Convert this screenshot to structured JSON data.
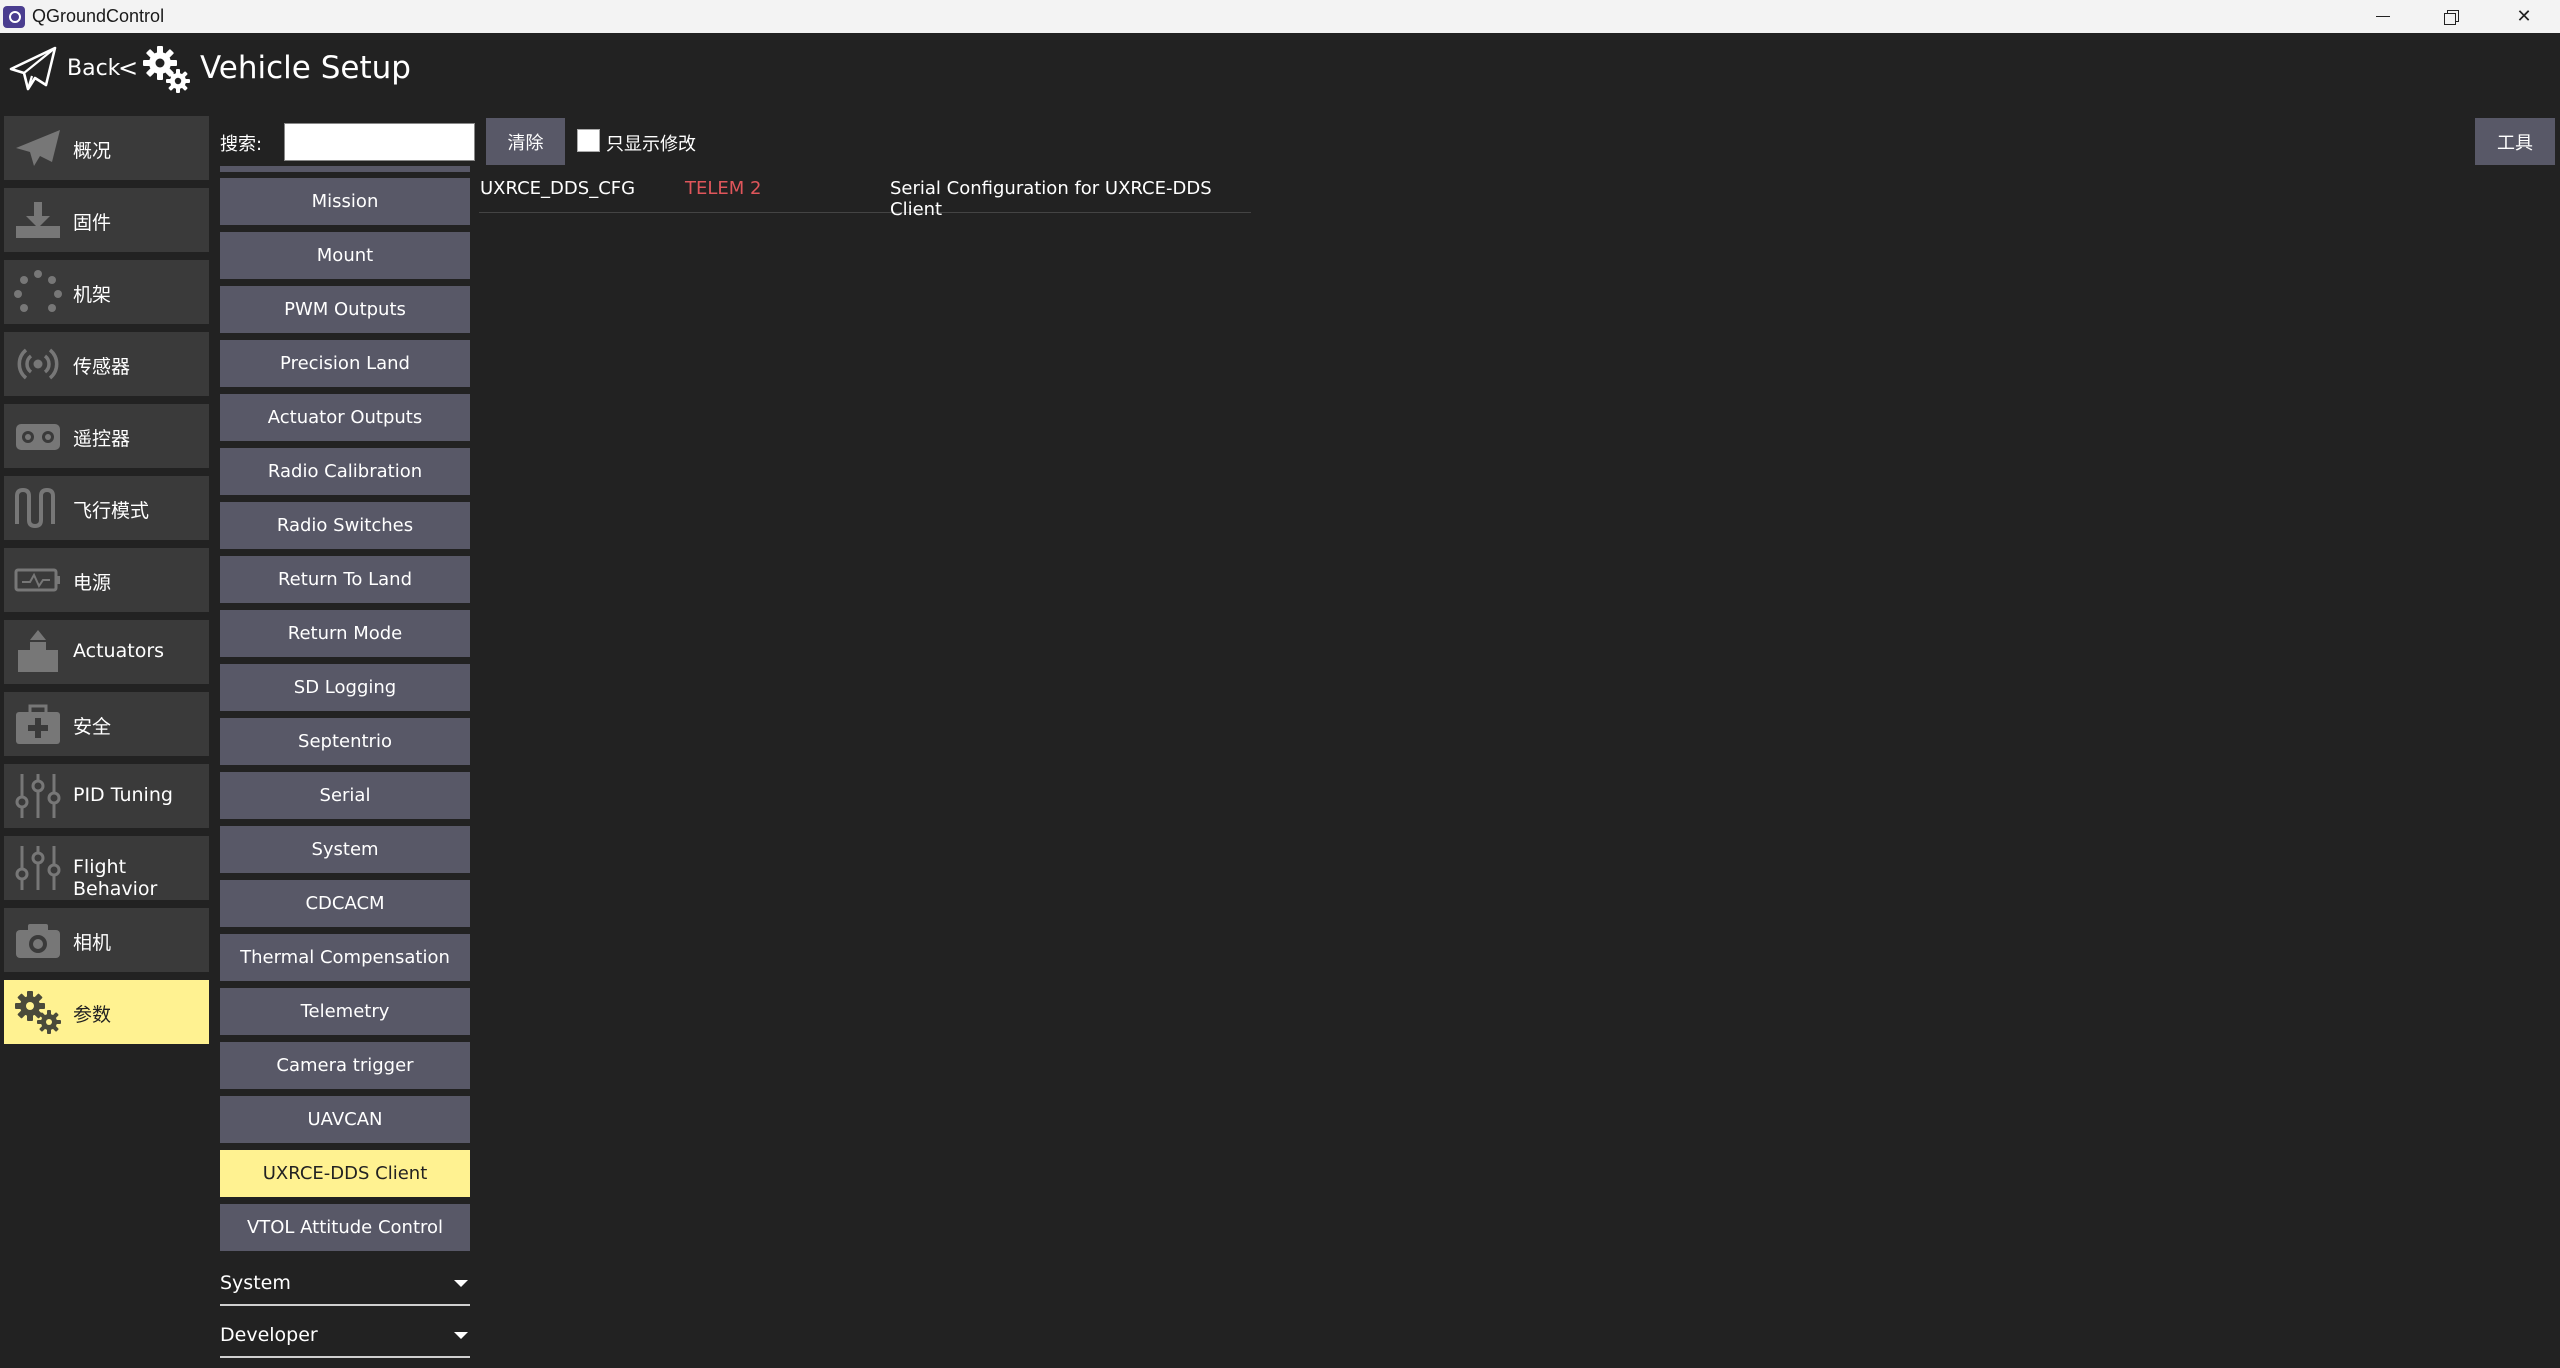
{
  "window": {
    "title": "QGroundControl"
  },
  "header": {
    "back_label": "Back",
    "separator": "<",
    "title": "Vehicle Setup"
  },
  "nav": {
    "items": [
      {
        "label": "概况",
        "icon": "paper-plane-icon"
      },
      {
        "label": "固件",
        "icon": "firmware-download-icon"
      },
      {
        "label": "机架",
        "icon": "airframe-icon"
      },
      {
        "label": "传感器",
        "icon": "sensors-icon"
      },
      {
        "label": "遥控器",
        "icon": "radio-icon"
      },
      {
        "label": "飞行模式",
        "icon": "flight-modes-icon"
      },
      {
        "label": "电源",
        "icon": "battery-icon"
      },
      {
        "label": "Actuators",
        "icon": "actuators-icon"
      },
      {
        "label": "安全",
        "icon": "safety-kit-icon"
      },
      {
        "label": "PID Tuning",
        "icon": "sliders-icon"
      },
      {
        "label": "Flight Behavior",
        "icon": "sliders-icon"
      },
      {
        "label": "相机",
        "icon": "camera-icon"
      },
      {
        "label": "参数",
        "icon": "gears-icon",
        "active": true
      }
    ]
  },
  "toolbar": {
    "search_label": "搜索:",
    "search_value": "",
    "clear_label": "清除",
    "show_modified_label": "只显示修改",
    "tools_label": "工具"
  },
  "groups": {
    "items": [
      "Mission",
      "Mount",
      "PWM Outputs",
      "Precision Land",
      "Actuator Outputs",
      "Radio Calibration",
      "Radio Switches",
      "Return To Land",
      "Return Mode",
      "SD Logging",
      "Septentrio",
      "Serial",
      "System",
      "CDCACM",
      "Thermal Compensation",
      "Telemetry",
      "Camera trigger",
      "UAVCAN",
      "UXRCE-DDS Client",
      "VTOL Attitude Control"
    ],
    "active": "UXRCE-DDS Client"
  },
  "categories": [
    {
      "label": "System"
    },
    {
      "label": "Developer"
    }
  ],
  "params": [
    {
      "name": "UXRCE_DDS_CFG",
      "value": "TELEM 2",
      "description": "Serial Configuration for UXRCE-DDS Client"
    }
  ],
  "colors": {
    "accent": "#fff291",
    "button": "#585867",
    "value_modified": "#e0565b",
    "background": "#222222"
  }
}
